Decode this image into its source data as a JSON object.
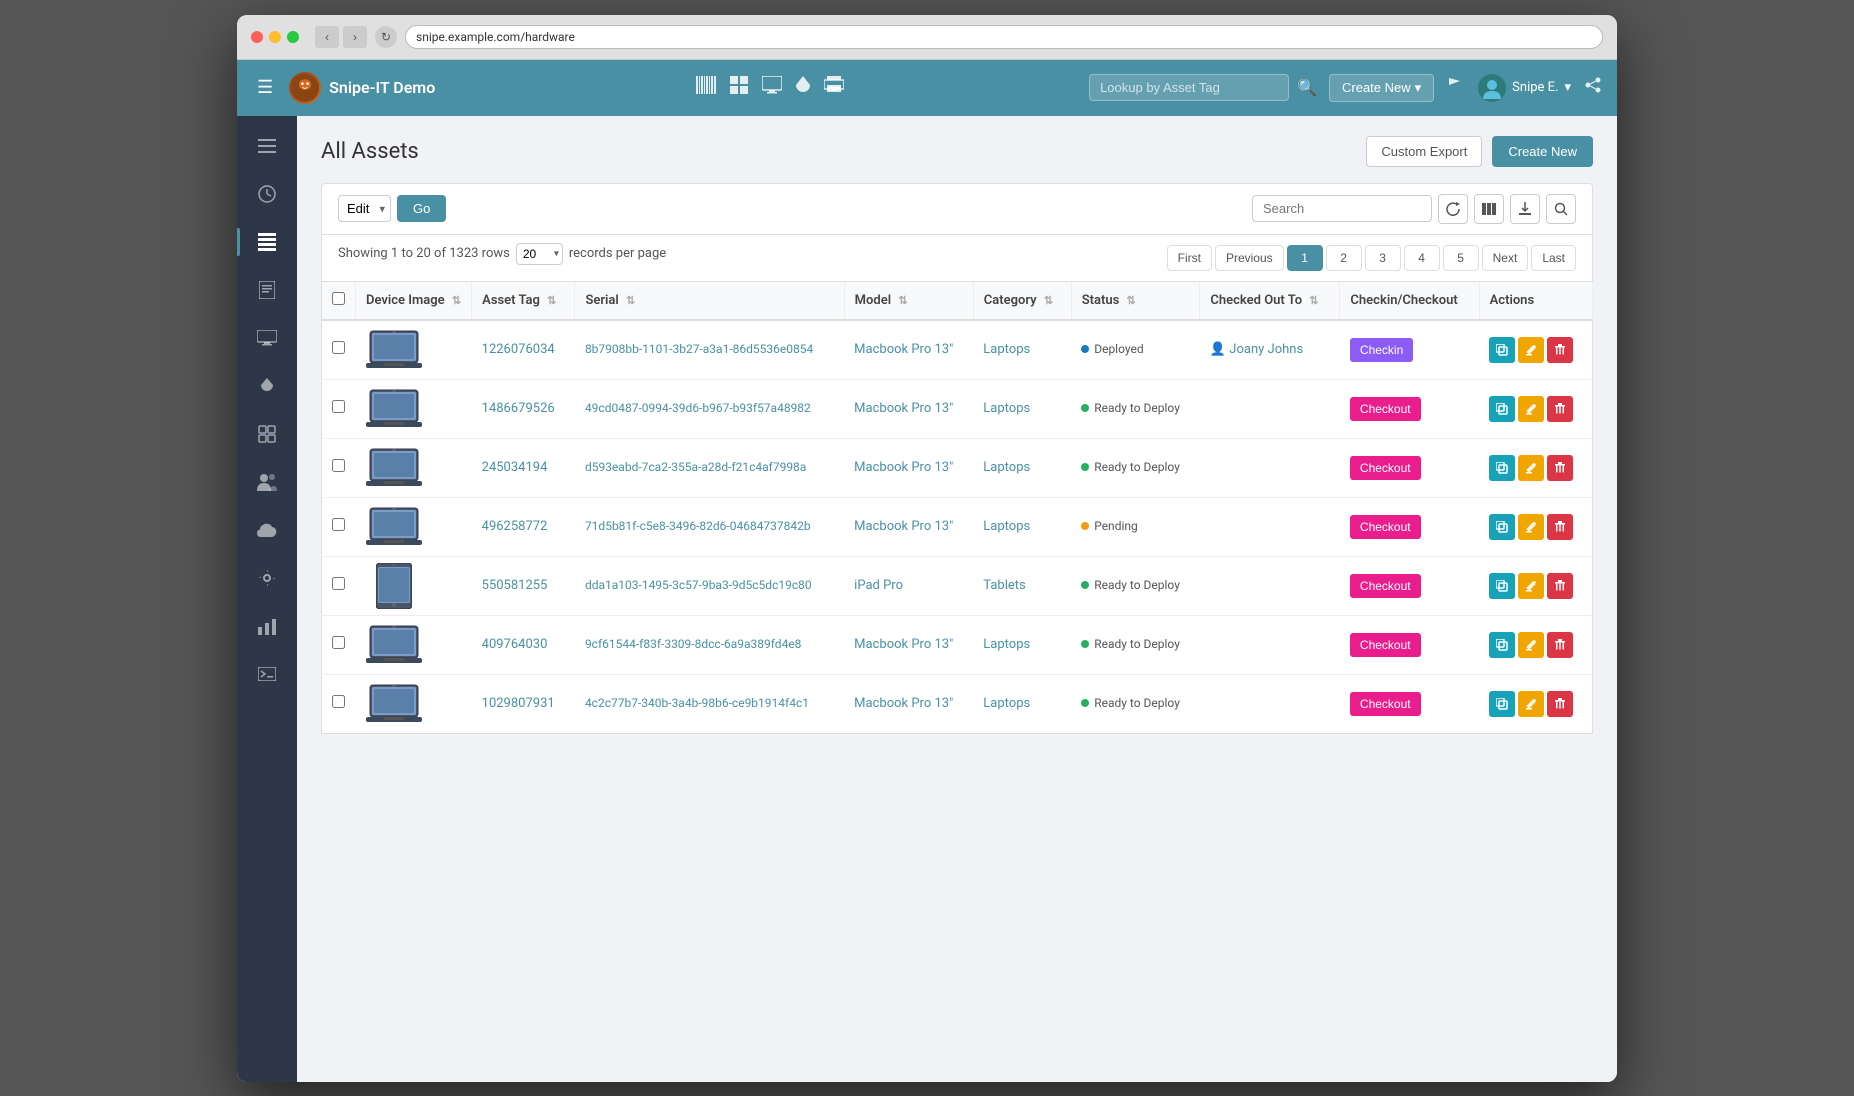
{
  "browser": {
    "url": "snipe.example.com/hardware"
  },
  "navbar": {
    "brand_name": "Snipe-IT Demo",
    "search_placeholder": "Lookup by Asset Tag",
    "create_new_label": "Create New",
    "user_label": "Snipe E.",
    "flag_icon": "flag-icon",
    "share_icon": "share-icon"
  },
  "sidebar": {
    "items": [
      {
        "icon": "☰",
        "name": "menu-icon",
        "active": false
      },
      {
        "icon": "📊",
        "name": "dashboard-icon",
        "active": false
      },
      {
        "icon": "📋",
        "name": "assets-icon",
        "active": true
      },
      {
        "icon": "📁",
        "name": "files-icon",
        "active": false
      },
      {
        "icon": "🖥",
        "name": "hardware-icon",
        "active": false
      },
      {
        "icon": "💧",
        "name": "consumables-icon",
        "active": false
      },
      {
        "icon": "🖨",
        "name": "components-icon",
        "active": false
      },
      {
        "icon": "👥",
        "name": "people-icon",
        "active": false
      },
      {
        "icon": "☁",
        "name": "cloud-icon",
        "active": false
      },
      {
        "icon": "⚙",
        "name": "settings-icon",
        "active": false
      },
      {
        "icon": "📈",
        "name": "reports-icon",
        "active": false
      },
      {
        "icon": "💻",
        "name": "laptop-icon",
        "active": false
      }
    ]
  },
  "page": {
    "title": "All Assets",
    "custom_export_label": "Custom Export",
    "create_new_label": "Create New"
  },
  "table_controls": {
    "edit_label": "Edit",
    "go_label": "Go",
    "search_placeholder": "Search",
    "showing_text": "Showing 1 to 20 of 1323 rows",
    "per_page_value": "20",
    "records_per_page_label": "records per page"
  },
  "pagination": {
    "first_label": "First",
    "previous_label": "Previous",
    "pages": [
      "1",
      "2",
      "3",
      "4",
      "5"
    ],
    "active_page": "1",
    "next_label": "Next",
    "last_label": "Last"
  },
  "table": {
    "columns": [
      {
        "label": "",
        "key": "checkbox"
      },
      {
        "label": "Device Image",
        "key": "device_image"
      },
      {
        "label": "Asset Tag",
        "key": "asset_tag"
      },
      {
        "label": "Serial",
        "key": "serial"
      },
      {
        "label": "Model",
        "key": "model"
      },
      {
        "label": "Category",
        "key": "category"
      },
      {
        "label": "Status",
        "key": "status"
      },
      {
        "label": "Checked Out To",
        "key": "checked_out_to"
      },
      {
        "label": "Checkin/Checkout",
        "key": "checkin_checkout"
      },
      {
        "label": "Actions",
        "key": "actions"
      }
    ],
    "rows": [
      {
        "asset_tag": "1226076034",
        "serial": "8b7908bb-1101-3b27-a3a1-86d5536e0854",
        "model": "Macbook Pro 13\"",
        "category": "Laptops",
        "status": "Deployed",
        "status_type": "deployed",
        "checked_out_to": "Joany Johns",
        "checkin_checkout_type": "checkin",
        "device_type": "laptop"
      },
      {
        "asset_tag": "1486679526",
        "serial": "49cd0487-0994-39d6-b967-b93f57a48982",
        "model": "Macbook Pro 13\"",
        "category": "Laptops",
        "status": "Ready to Deploy",
        "status_type": "ready",
        "checked_out_to": "",
        "checkin_checkout_type": "checkout",
        "device_type": "laptop"
      },
      {
        "asset_tag": "245034194",
        "serial": "d593eabd-7ca2-355a-a28d-f21c4af7998a",
        "model": "Macbook Pro 13\"",
        "category": "Laptops",
        "status": "Ready to Deploy",
        "status_type": "ready",
        "checked_out_to": "",
        "checkin_checkout_type": "checkout",
        "device_type": "laptop"
      },
      {
        "asset_tag": "496258772",
        "serial": "71d5b81f-c5e8-3496-82d6-04684737842b",
        "model": "Macbook Pro 13\"",
        "category": "Laptops",
        "status": "Pending",
        "status_type": "pending",
        "checked_out_to": "",
        "checkin_checkout_type": "checkout",
        "device_type": "laptop"
      },
      {
        "asset_tag": "550581255",
        "serial": "dda1a103-1495-3c57-9ba3-9d5c5dc19c80",
        "model": "iPad Pro",
        "category": "Tablets",
        "status": "Ready to Deploy",
        "status_type": "ready",
        "checked_out_to": "",
        "checkin_checkout_type": "checkout",
        "device_type": "tablet"
      },
      {
        "asset_tag": "409764030",
        "serial": "9cf61544-f83f-3309-8dcc-6a9a389fd4e8",
        "model": "Macbook Pro 13\"",
        "category": "Laptops",
        "status": "Ready to Deploy",
        "status_type": "ready",
        "checked_out_to": "",
        "checkin_checkout_type": "checkout",
        "device_type": "laptop"
      },
      {
        "asset_tag": "1029807931",
        "serial": "4c2c77b7-340b-3a4b-98b6-ce9b1914f4c1",
        "model": "Macbook Pro 13\"",
        "category": "Laptops",
        "status": "Ready to Deploy",
        "status_type": "ready",
        "checked_out_to": "",
        "checkin_checkout_type": "checkout",
        "device_type": "laptop"
      }
    ]
  }
}
